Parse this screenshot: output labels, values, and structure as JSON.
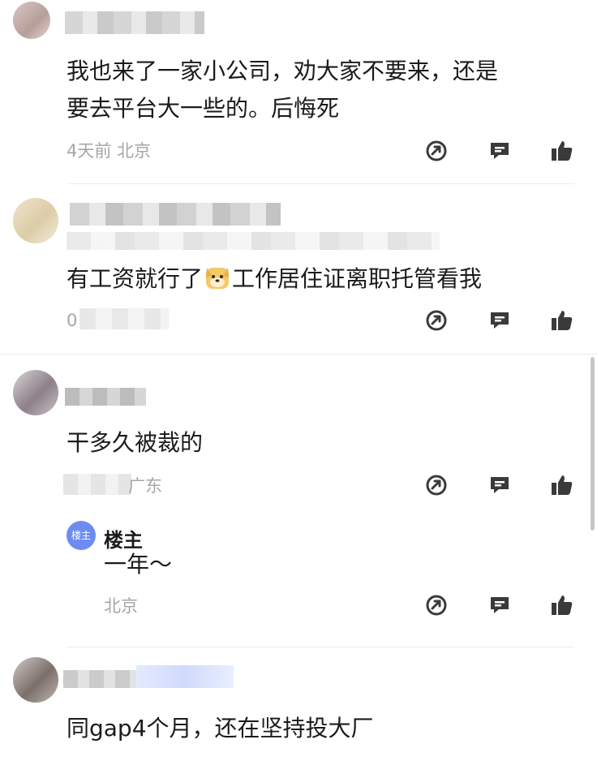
{
  "comments": [
    {
      "text": "我也来了一家小公司，劝大家不要来，还是要去平台大一些的。后悔死",
      "line1": "我也来了一家小公司，劝大家不要来，还是",
      "line2": "要去平台大一些的。后悔死",
      "meta": "4天前  北京"
    },
    {
      "text_before_emoji": "有工资就行了",
      "emoji": "doge-emoji",
      "text_after_emoji": "工作居住证离职托管看我",
      "meta_visible": "0"
    },
    {
      "text": "干多久被裁的",
      "meta_visible": "广东"
    },
    {
      "text": "同gap4个月，还在坚持投大厂"
    }
  ],
  "reply": {
    "badge": "楼主",
    "author": "楼主",
    "text": "一年～",
    "meta": "北京"
  },
  "actions": {
    "share_icon": "share-icon",
    "comment_icon": "comment-icon",
    "like_icon": "thumbs-up-icon"
  },
  "colors": {
    "icon": "#3a3a3a",
    "meta": "#a6a6a6",
    "badge": "#6d8cf2",
    "text": "#1b1b1b"
  }
}
